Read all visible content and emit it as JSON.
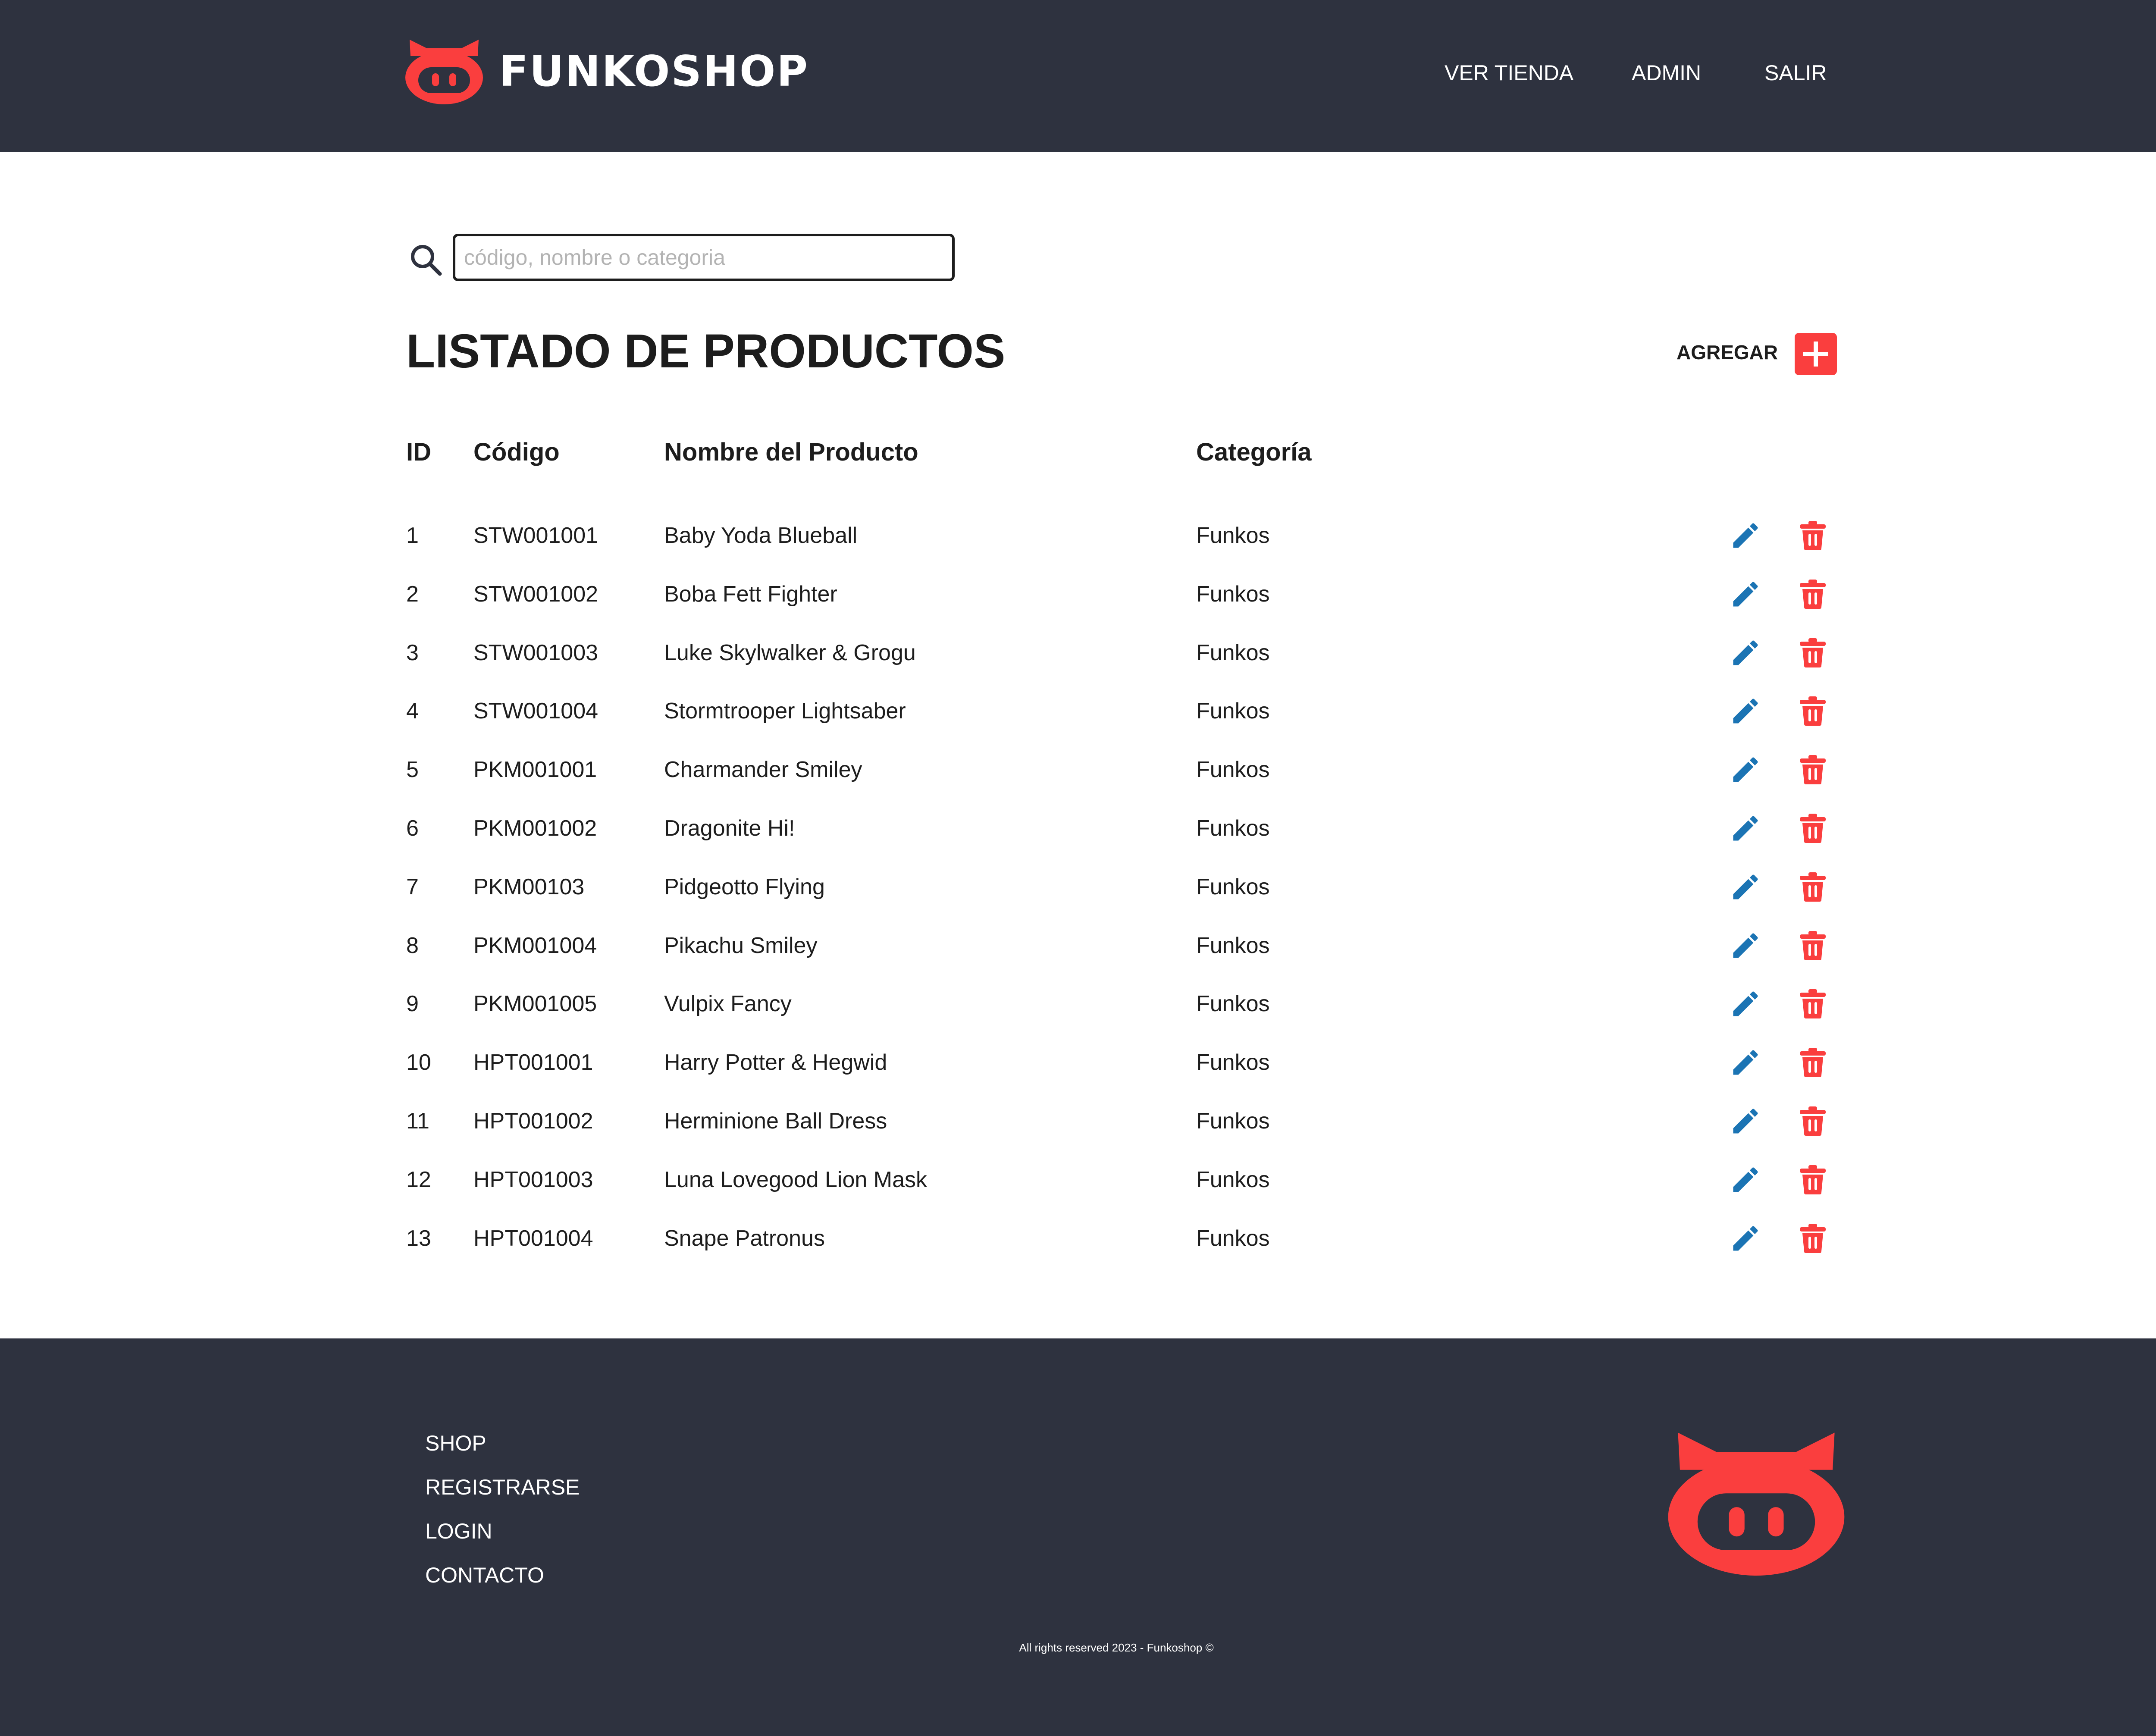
{
  "header": {
    "brand": "FUNKOSHOP",
    "nav": [
      "VER TIENDA",
      "ADMIN",
      "SALIR"
    ]
  },
  "search": {
    "placeholder": "código, nombre o categoria",
    "icon": "search-icon"
  },
  "main": {
    "title": "LISTADO DE PRODUCTOS",
    "add_label": "AGREGAR"
  },
  "table": {
    "headers": [
      "ID",
      "Código",
      "Nombre del Producto",
      "Categoría"
    ],
    "rows": [
      {
        "id": "1",
        "code": "STW001001",
        "name": "Baby Yoda Blueball",
        "category": "Funkos"
      },
      {
        "id": "2",
        "code": "STW001002",
        "name": "Boba Fett Fighter",
        "category": "Funkos"
      },
      {
        "id": "3",
        "code": "STW001003",
        "name": "Luke Skylwalker & Grogu",
        "category": "Funkos"
      },
      {
        "id": "4",
        "code": "STW001004",
        "name": "Stormtrooper Lightsaber",
        "category": "Funkos"
      },
      {
        "id": "5",
        "code": "PKM001001",
        "name": "Charmander Smiley",
        "category": "Funkos"
      },
      {
        "id": "6",
        "code": "PKM001002",
        "name": "Dragonite Hi!",
        "category": "Funkos"
      },
      {
        "id": "7",
        "code": "PKM00103",
        "name": "Pidgeotto Flying",
        "category": "Funkos"
      },
      {
        "id": "8",
        "code": "PKM001004",
        "name": "Pikachu Smiley",
        "category": "Funkos"
      },
      {
        "id": "9",
        "code": "PKM001005",
        "name": "Vulpix Fancy",
        "category": "Funkos"
      },
      {
        "id": "10",
        "code": "HPT001001",
        "name": "Harry Potter & Hegwid",
        "category": "Funkos"
      },
      {
        "id": "11",
        "code": "HPT001002",
        "name": "Herminione Ball Dress",
        "category": "Funkos"
      },
      {
        "id": "12",
        "code": "HPT001003",
        "name": "Luna Lovegood Lion Mask",
        "category": "Funkos"
      },
      {
        "id": "13",
        "code": "HPT001004",
        "name": "Snape Patronus",
        "category": "Funkos"
      }
    ],
    "row_actions": [
      "edit-icon",
      "delete-icon"
    ]
  },
  "footer": {
    "links": [
      "SHOP",
      "REGISTRARSE",
      "LOGIN",
      "CONTACTO"
    ],
    "copyright": "All rights reserved 2023 - Funkoshop ©"
  },
  "colors": {
    "dark": "#2e323f",
    "accent": "#fa3e3e",
    "edit": "#1b74b4",
    "text": "#1d1d1d"
  }
}
